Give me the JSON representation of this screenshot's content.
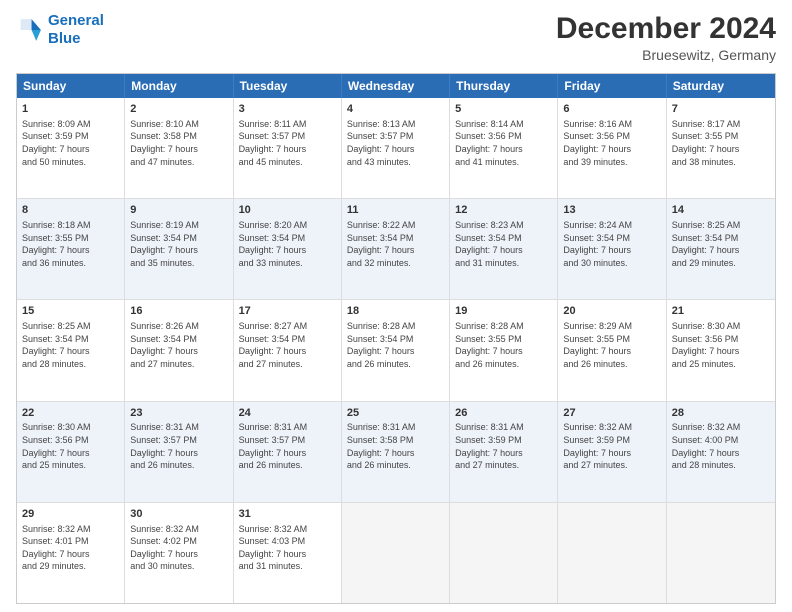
{
  "header": {
    "logo_line1": "General",
    "logo_line2": "Blue",
    "main_title": "December 2024",
    "subtitle": "Bruesewitz, Germany"
  },
  "calendar": {
    "days_of_week": [
      "Sunday",
      "Monday",
      "Tuesday",
      "Wednesday",
      "Thursday",
      "Friday",
      "Saturday"
    ],
    "weeks": [
      [
        {
          "day": "",
          "info": ""
        },
        {
          "day": "2",
          "info": "Sunrise: 8:10 AM\nSunset: 3:58 PM\nDaylight: 7 hours\nand 47 minutes."
        },
        {
          "day": "3",
          "info": "Sunrise: 8:11 AM\nSunset: 3:57 PM\nDaylight: 7 hours\nand 45 minutes."
        },
        {
          "day": "4",
          "info": "Sunrise: 8:13 AM\nSunset: 3:57 PM\nDaylight: 7 hours\nand 43 minutes."
        },
        {
          "day": "5",
          "info": "Sunrise: 8:14 AM\nSunset: 3:56 PM\nDaylight: 7 hours\nand 41 minutes."
        },
        {
          "day": "6",
          "info": "Sunrise: 8:16 AM\nSunset: 3:56 PM\nDaylight: 7 hours\nand 39 minutes."
        },
        {
          "day": "7",
          "info": "Sunrise: 8:17 AM\nSunset: 3:55 PM\nDaylight: 7 hours\nand 38 minutes."
        },
        {
          "day": "1",
          "info": "Sunrise: 8:09 AM\nSunset: 3:59 PM\nDaylight: 7 hours\nand 50 minutes.",
          "first": true
        }
      ],
      [
        {
          "day": "8",
          "info": "Sunrise: 8:18 AM\nSunset: 3:55 PM\nDaylight: 7 hours\nand 36 minutes."
        },
        {
          "day": "9",
          "info": "Sunrise: 8:19 AM\nSunset: 3:54 PM\nDaylight: 7 hours\nand 35 minutes."
        },
        {
          "day": "10",
          "info": "Sunrise: 8:20 AM\nSunset: 3:54 PM\nDaylight: 7 hours\nand 33 minutes."
        },
        {
          "day": "11",
          "info": "Sunrise: 8:22 AM\nSunset: 3:54 PM\nDaylight: 7 hours\nand 32 minutes."
        },
        {
          "day": "12",
          "info": "Sunrise: 8:23 AM\nSunset: 3:54 PM\nDaylight: 7 hours\nand 31 minutes."
        },
        {
          "day": "13",
          "info": "Sunrise: 8:24 AM\nSunset: 3:54 PM\nDaylight: 7 hours\nand 30 minutes."
        },
        {
          "day": "14",
          "info": "Sunrise: 8:25 AM\nSunset: 3:54 PM\nDaylight: 7 hours\nand 29 minutes."
        }
      ],
      [
        {
          "day": "15",
          "info": "Sunrise: 8:25 AM\nSunset: 3:54 PM\nDaylight: 7 hours\nand 28 minutes."
        },
        {
          "day": "16",
          "info": "Sunrise: 8:26 AM\nSunset: 3:54 PM\nDaylight: 7 hours\nand 27 minutes."
        },
        {
          "day": "17",
          "info": "Sunrise: 8:27 AM\nSunset: 3:54 PM\nDaylight: 7 hours\nand 27 minutes."
        },
        {
          "day": "18",
          "info": "Sunrise: 8:28 AM\nSunset: 3:54 PM\nDaylight: 7 hours\nand 26 minutes."
        },
        {
          "day": "19",
          "info": "Sunrise: 8:28 AM\nSunset: 3:55 PM\nDaylight: 7 hours\nand 26 minutes."
        },
        {
          "day": "20",
          "info": "Sunrise: 8:29 AM\nSunset: 3:55 PM\nDaylight: 7 hours\nand 26 minutes."
        },
        {
          "day": "21",
          "info": "Sunrise: 8:30 AM\nSunset: 3:56 PM\nDaylight: 7 hours\nand 25 minutes."
        }
      ],
      [
        {
          "day": "22",
          "info": "Sunrise: 8:30 AM\nSunset: 3:56 PM\nDaylight: 7 hours\nand 25 minutes."
        },
        {
          "day": "23",
          "info": "Sunrise: 8:31 AM\nSunset: 3:57 PM\nDaylight: 7 hours\nand 26 minutes."
        },
        {
          "day": "24",
          "info": "Sunrise: 8:31 AM\nSunset: 3:57 PM\nDaylight: 7 hours\nand 26 minutes."
        },
        {
          "day": "25",
          "info": "Sunrise: 8:31 AM\nSunset: 3:58 PM\nDaylight: 7 hours\nand 26 minutes."
        },
        {
          "day": "26",
          "info": "Sunrise: 8:31 AM\nSunset: 3:59 PM\nDaylight: 7 hours\nand 27 minutes."
        },
        {
          "day": "27",
          "info": "Sunrise: 8:32 AM\nSunset: 3:59 PM\nDaylight: 7 hours\nand 27 minutes."
        },
        {
          "day": "28",
          "info": "Sunrise: 8:32 AM\nSunset: 4:00 PM\nDaylight: 7 hours\nand 28 minutes."
        }
      ],
      [
        {
          "day": "29",
          "info": "Sunrise: 8:32 AM\nSunset: 4:01 PM\nDaylight: 7 hours\nand 29 minutes."
        },
        {
          "day": "30",
          "info": "Sunrise: 8:32 AM\nSunset: 4:02 PM\nDaylight: 7 hours\nand 30 minutes."
        },
        {
          "day": "31",
          "info": "Sunrise: 8:32 AM\nSunset: 4:03 PM\nDaylight: 7 hours\nand 31 minutes."
        },
        {
          "day": "",
          "info": ""
        },
        {
          "day": "",
          "info": ""
        },
        {
          "day": "",
          "info": ""
        },
        {
          "day": "",
          "info": ""
        }
      ]
    ]
  }
}
